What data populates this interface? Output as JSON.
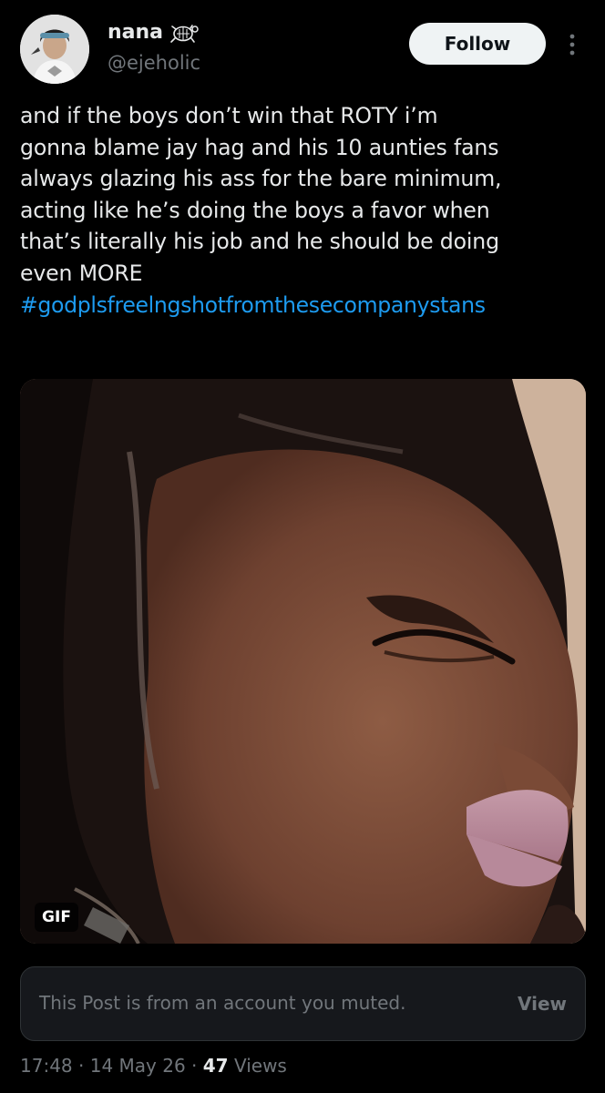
{
  "author": {
    "display_name": "nana",
    "handle": "@ejeholic",
    "badge_icon": "turtle-icon",
    "avatar_icon": "avatar-icon"
  },
  "actions": {
    "follow_label": "Follow",
    "more_icon": "more-vertical-icon"
  },
  "post": {
    "text_lines": [
      "and if the boys don’t win that ROTY i’m",
      "gonna blame jay hag and his 10 aunties fans",
      "always glazing his ass for the bare minimum,",
      "acting like he’s doing the boys a favor when",
      "that’s literally his job and he should be doing",
      "even MORE"
    ],
    "hashtag": "#godplsfreelngshotfromthesecompanystans"
  },
  "media": {
    "type": "gif",
    "badge_label": "GIF"
  },
  "quoted_post": {
    "muted_text": "This Post is from an account you muted.",
    "view_label": "View"
  },
  "meta": {
    "time": "17:48",
    "separator": " · ",
    "date": "14 May 26",
    "views_count": "47",
    "views_label": "Views"
  },
  "colors": {
    "background": "#000000",
    "text_primary": "#e7e9ea",
    "text_secondary": "#71767b",
    "link": "#1d9bf0",
    "follow_bg": "#eff3f4",
    "card_border": "#2f3336"
  }
}
